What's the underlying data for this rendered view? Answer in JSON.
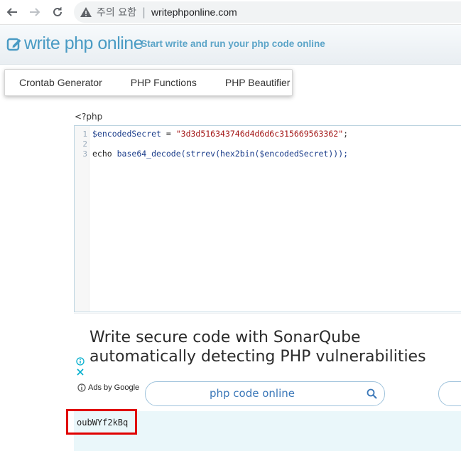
{
  "browser": {
    "security_label": "주의 요함",
    "separator": "|",
    "url": "writephponline.com"
  },
  "site": {
    "logo_text": "write php online",
    "tagline": "- Start write and run your php code online"
  },
  "menu": {
    "items": [
      {
        "label": "Crontab Generator"
      },
      {
        "label": "PHP Functions"
      },
      {
        "label": "PHP Beautifier"
      }
    ]
  },
  "editor": {
    "open_tag": "<?php",
    "lines": [
      {
        "number": "1",
        "var": "$encodedSecret",
        "op": " = ",
        "string": "\"3d3d516343746d4d6d6c315669563362\"",
        "end": ";"
      },
      {
        "number": "2"
      },
      {
        "number": "3",
        "kw": "echo ",
        "call_1": "base64_decode(strrev(hex2bin(",
        "var": "$encodedSecret",
        "call_2": ")));"
      }
    ]
  },
  "ad": {
    "headline": "Write secure code with SonarQube automatically detecting PHP vulnerabilities",
    "ads_by_google": "Ads by Google",
    "search_text": "php code online"
  },
  "output": {
    "text": "oubWYf2kBq"
  },
  "colors": {
    "accent": "#4a9bc4",
    "highlight_border": "#e00000",
    "output_bg": "#eaf7fa"
  }
}
